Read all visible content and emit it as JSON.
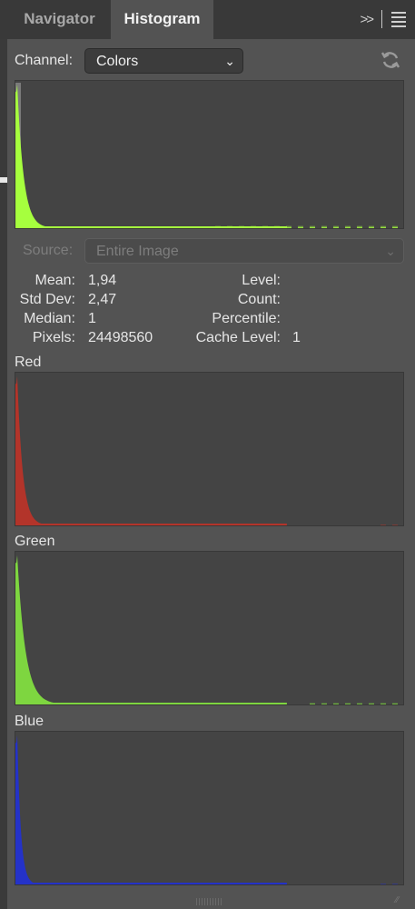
{
  "tabs": {
    "navigator": "Navigator",
    "histogram": "Histogram"
  },
  "toolbar": {
    "collapse": ">>"
  },
  "channel": {
    "label": "Channel:",
    "value": "Colors"
  },
  "source": {
    "label": "Source:",
    "value": "Entire Image"
  },
  "stats": {
    "mean": {
      "label": "Mean:",
      "value": "1,94"
    },
    "std_dev": {
      "label": "Std Dev:",
      "value": "2,47"
    },
    "median": {
      "label": "Median:",
      "value": "1"
    },
    "pixels": {
      "label": "Pixels:",
      "value": "24498560"
    },
    "level": {
      "label": "Level:",
      "value": ""
    },
    "count": {
      "label": "Count:",
      "value": ""
    },
    "percentile": {
      "label": "Percentile:",
      "value": ""
    },
    "cache_level": {
      "label": "Cache Level:",
      "value": "1"
    }
  },
  "channels": {
    "red": {
      "label": "Red",
      "color": "#b3342a"
    },
    "green": {
      "label": "Green",
      "color": "#7ed640"
    },
    "blue": {
      "label": "Blue",
      "color": "#2432c8"
    },
    "colors": {
      "color": "#a6ff3e"
    }
  },
  "colors": {
    "panel_bg": "#535353",
    "tab_bar": "#393939",
    "histogram_bg": "#444444"
  }
}
